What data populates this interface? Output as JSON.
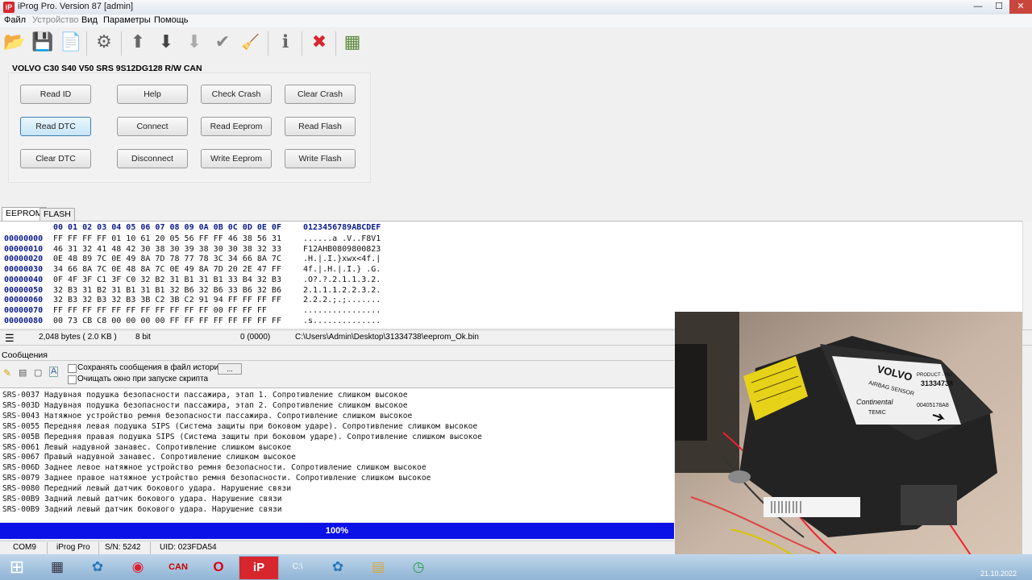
{
  "window": {
    "title": "iProg Pro. Version 87 [admin]",
    "icon_label": "iP",
    "minimize": "—",
    "maximize": "☐",
    "close": "✕"
  },
  "menu": [
    "Файл",
    "Устройство",
    "Вид",
    "Параметры",
    "Помощь"
  ],
  "toolbar": {
    "icons": [
      "open-icon",
      "save-icon",
      "file-icon",
      "chip-icon",
      "arrow-up-icon",
      "arrow-down-icon",
      "arrow-down-disabled-icon",
      "check-icon",
      "broom-icon",
      "info-icon",
      "close-red-icon",
      "calculator-icon"
    ],
    "glyphs": [
      "📂",
      "💾",
      "📄",
      "⚙",
      "⬆",
      "⬇",
      "⬇",
      "✔",
      "🧹",
      "ℹ",
      "✖",
      "▦"
    ]
  },
  "device": {
    "title": "VOLVO C30 S40 V50 SRS 9S12DG128 R/W CAN"
  },
  "buttons": {
    "read_id": "Read ID",
    "help": "Help",
    "check_crash": "Check Crash",
    "clear_crash": "Clear Crash",
    "read_dtc": "Read DTC",
    "connect": "Connect",
    "read_eeprom": "Read Eeprom",
    "read_flash": "Read Flash",
    "clear_dtc": "Clear DTC",
    "disconnect": "Disconnect",
    "write_eeprom": "Write Eeprom",
    "write_flash": "Write Flash"
  },
  "tabs": {
    "eeprom": "EEPROM",
    "flash": "FLASH"
  },
  "hex": {
    "header": "00 01 02 03 04 05 06 07 08 09 0A 0B 0C 0D 0E 0F",
    "ascii_header": "0123456789ABCDEF",
    "rows": [
      {
        "addr": "00000000",
        "bytes": "FF FF FF FF 01 10 61 20 05 56 FF FF 46 38 56 31",
        "ascii": "......a .V..F8V1"
      },
      {
        "addr": "00000010",
        "bytes": "46 31 32 41 48 42 30 38 30 39 38 30 30 38 32 33",
        "ascii": "F12AHB0809800823"
      },
      {
        "addr": "00000020",
        "bytes": "0E 48 89 7C 0E 49 8A 7D 78 77 78 3C 34 66 8A 7C",
        "ascii": ".H.|.I.}xwx<4f.|"
      },
      {
        "addr": "00000030",
        "bytes": "34 66 8A 7C 0E 48 8A 7C 0E 49 8A 7D 20 2E 47 FF",
        "ascii": "4f.|.H.|.I.} .G."
      },
      {
        "addr": "00000040",
        "bytes": "0F 4F 3F C1 3F C0 32 B2 31 B1 31 B1 33 B4 32 B3",
        "ascii": ".O?.?.2.1.1.3.2."
      },
      {
        "addr": "00000050",
        "bytes": "32 B3 31 B2 31 B1 31 B1 32 B6 32 B6 33 B6 32 B6",
        "ascii": "2.1.1.1.2.2.3.2."
      },
      {
        "addr": "00000060",
        "bytes": "32 B3 32 B3 32 B3 3B C2 3B C2 91 94 FF FF FF FF",
        "ascii": "2.2.2.;.;......."
      },
      {
        "addr": "00000070",
        "bytes": "FF FF FF FF FF FF FF FF FF FF FF 00 FF FF FF",
        "ascii": "................"
      },
      {
        "addr": "00000080",
        "bytes": "00 73 CB C8 00 00 00 00 FF FF FF FF FF FF FF FF",
        "ascii": ".s.............."
      }
    ]
  },
  "hex_status": {
    "size": "2,048 bytes ( 2.0 KB )",
    "bits": "8 bit",
    "offset": "0 (0000)",
    "path": "C:\\Users\\Admin\\Desktop\\31334738\\eeprom_Ok.bin"
  },
  "messages": {
    "label": "Сообщения",
    "save_option": "Сохранять сообщения в файл истории",
    "browse": "...",
    "clear_option": "Очищать окно при запуске скрипта",
    "lines": [
      "SRS-0037 Надувная подушка безопасности пассажира, этап 1. Сопротивление слишком высокое",
      "SRS-003D Надувная подушка безопасности пассажира, этап 2. Сопротивление слишком высокое",
      "SRS-0043 Натяжное устройство ремня безопасности пассажира. Сопротивление слишком высокое",
      "SRS-0055 Передняя левая подушка SIPS (Система защиты при боковом ударе). Сопротивление слишком высокое",
      "SRS-005B Передняя правая подушка SIPS (Система защиты при боковом ударе). Сопротивление слишком высокое",
      "SRS-0061 Левый надувной занавес. Сопротивление слишком высокое",
      "SRS-0067 Правый надувной занавес. Сопротивление слишком высокое",
      "SRS-006D Заднее левое натяжное устройство ремня безопасности. Сопротивление слишком высокое",
      "SRS-0079 Заднее правое натяжное устройство ремня безопасности. Сопротивление слишком высокое",
      "SRS-0080 Передний левый датчик бокового удара. Нарушение связи",
      "SRS-00B9 Задний левый датчик бокового удара. Нарушение связи",
      "SRS-00B9 Задний левый датчик бокового удара. Нарушение связи"
    ]
  },
  "progress": {
    "label": "100%",
    "value": 1.0
  },
  "status": {
    "port": "COM9",
    "app": "iProg Pro",
    "sn": "S/N: 5242",
    "uid": "UID: 023FDA54"
  },
  "photo": {
    "brand": "VOLVO",
    "sensor_label": "AIRBAG SENSOR",
    "product_no_label": "PRODUCT - NO",
    "product_no": "31334738",
    "maker": "Continental",
    "maker2": "TEMIC",
    "part": "00405178A8"
  },
  "taskbar": {
    "icons": [
      "start-orb-icon",
      "calculator-icon",
      "network-icon",
      "chrome-icon",
      "can-icon",
      "opera-icon",
      "iprog-icon",
      "cmd-icon",
      "network2-icon",
      "folder-icon",
      "clock-app-icon"
    ],
    "glyphs": [
      "⊞",
      "▦",
      "✿",
      "◉",
      "CAN",
      "O",
      "iP",
      "C:\\",
      "✿",
      "▤",
      "◷"
    ],
    "date": "21.10.2022"
  },
  "colors": {
    "progress": "#0b12e8",
    "hex_address": "#0b1a8c",
    "close": "#d8262d"
  }
}
